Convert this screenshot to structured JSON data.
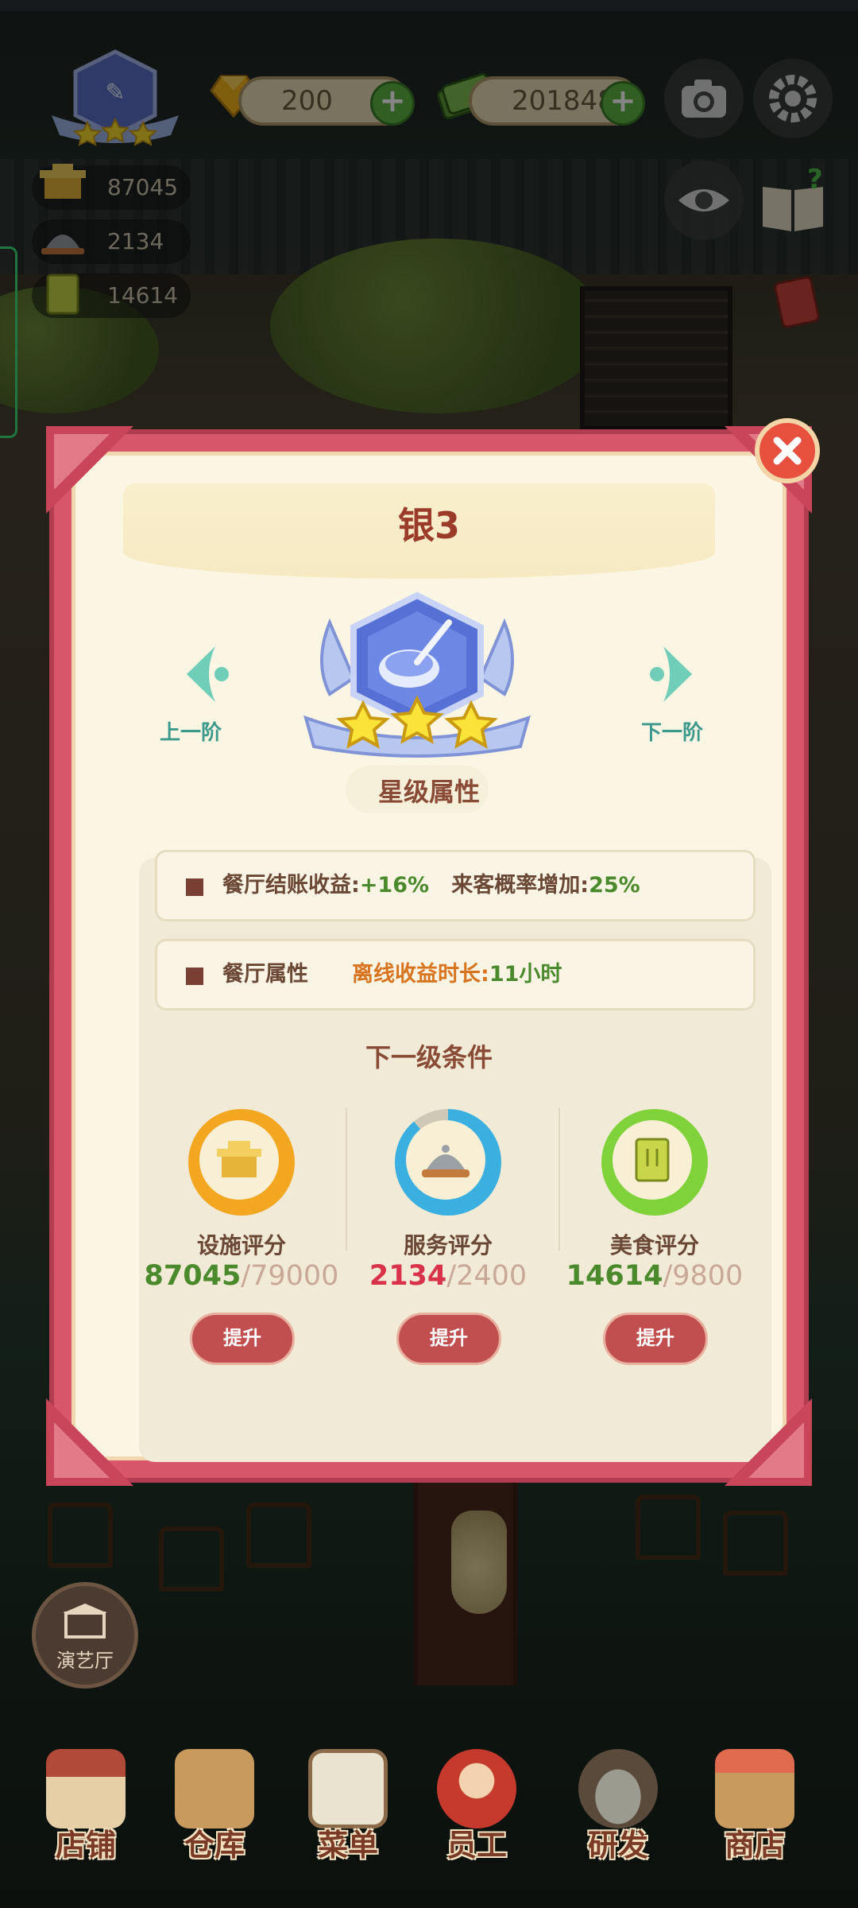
{
  "hud": {
    "gems": "200",
    "cash": "201848",
    "facility_points": "87045",
    "service_points": "2134",
    "food_points": "14614"
  },
  "modal": {
    "rank_title": "银3",
    "prev_label": "上一阶",
    "next_label": "下一阶",
    "star_attr_title": "星级属性",
    "attr1": {
      "name": "餐厅结账收益",
      "sep": ":",
      "value1": "+16%",
      "label2": "来客概率增加",
      "sep2": ":",
      "value2": "25%"
    },
    "attr2": {
      "name": "餐厅属性",
      "label": "离线收益时长",
      "sep": ":",
      "value": "11小时"
    },
    "next_cond_title": "下一级条件",
    "conditions": [
      {
        "label": "设施评分",
        "current": "87045",
        "target": "79000",
        "button": "提升",
        "ring_color": "#f3a61f",
        "value_color": "#4a8a2c",
        "progress": 1.0
      },
      {
        "label": "服务评分",
        "current": "2134",
        "target": "2400",
        "button": "提升",
        "ring_color": "#3bb0e0",
        "value_color": "#d8334a",
        "progress": 0.89
      },
      {
        "label": "美食评分",
        "current": "14614",
        "target": "9800",
        "button": "提升",
        "ring_color": "#7fd23a",
        "value_color": "#4a8a2c",
        "progress": 1.0
      }
    ]
  },
  "side_button": {
    "label": "演艺厅"
  },
  "nav": {
    "items": [
      {
        "label": "店铺"
      },
      {
        "label": "仓库"
      },
      {
        "label": "菜单"
      },
      {
        "label": "员工"
      },
      {
        "label": "研发"
      },
      {
        "label": "商店"
      }
    ]
  },
  "colors": {
    "modal_border": "#d7566a",
    "modal_bg": "#fbf5e3",
    "title": "#9b3b2a",
    "accent_green": "#4a8a2c",
    "accent_orange": "#d8741f"
  }
}
